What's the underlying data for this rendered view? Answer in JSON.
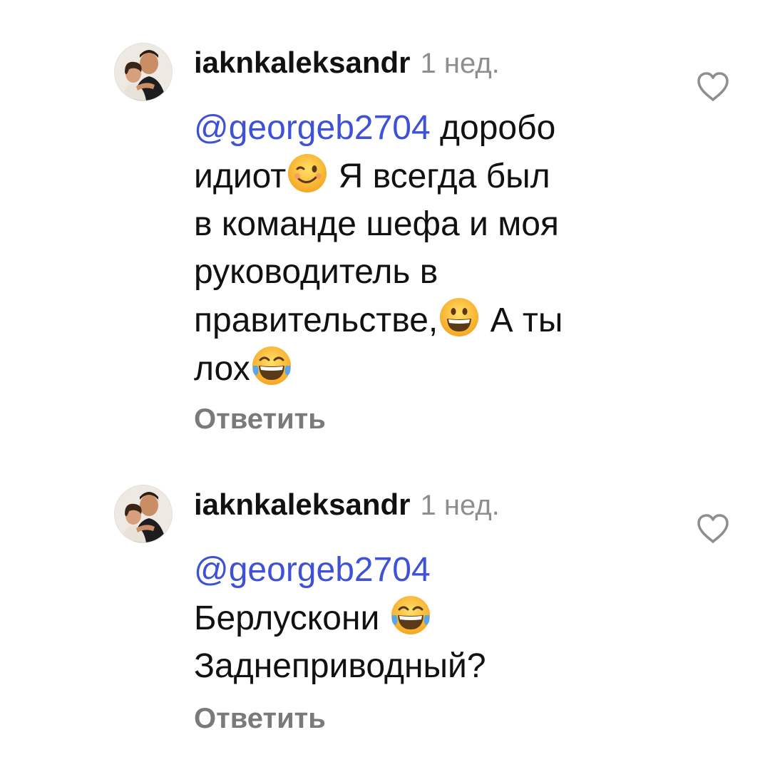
{
  "colors": {
    "mention": "#3f51d4",
    "secondary_text": "#8e8e8e",
    "reply": "#7a7a7a"
  },
  "comments": [
    {
      "username": "iaknkaleksandr",
      "time": "1 нед.",
      "mention": "@georgeb2704",
      "text_parts": [
        "доробо",
        "идиот",
        "Я всегда был",
        "в команде шефа и моя",
        "руководитель в",
        "правительстве,",
        "А ты",
        "лох"
      ],
      "emojis": [
        "winking-face-emoji",
        "grinning-face-emoji",
        "tears-of-joy-emoji"
      ],
      "reply_label": "Ответить",
      "like_icon": "heart-outline-icon"
    },
    {
      "username": "iaknkaleksandr",
      "time": "1 нед.",
      "mention": "@georgeb2704",
      "text_parts": [
        "Берлускони",
        "Заднеприводный?"
      ],
      "emojis": [
        "tears-of-joy-emoji"
      ],
      "reply_label": "Ответить",
      "like_icon": "heart-outline-icon"
    }
  ]
}
